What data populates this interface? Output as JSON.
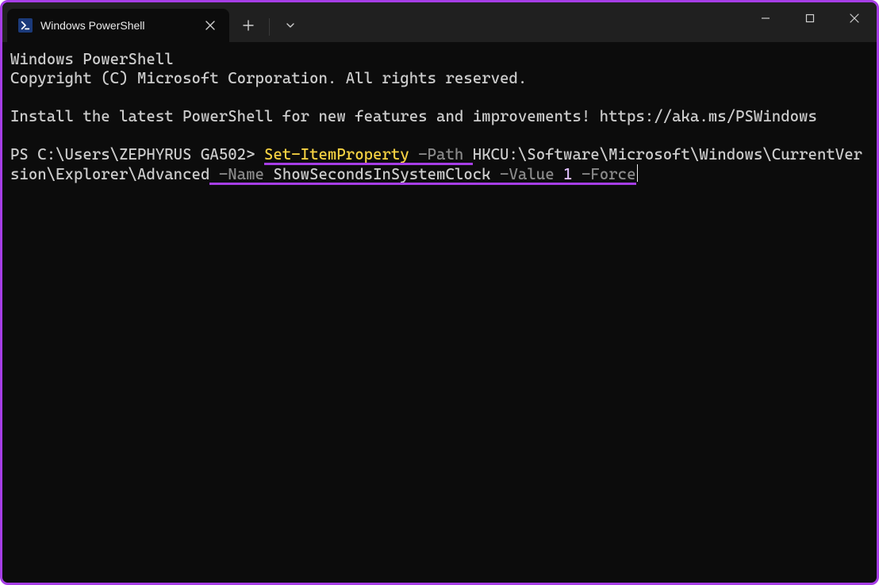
{
  "colors": {
    "accent": "#a63ee6"
  },
  "tab": {
    "title": "Windows PowerShell"
  },
  "terminal": {
    "header_line1": "Windows PowerShell",
    "header_line2": "Copyright (C) Microsoft Corporation. All rights reserved.",
    "install_msg": "Install the latest PowerShell for new features and improvements! https://aka.ms/PSWindows",
    "prompt_prefix": "PS ",
    "prompt_path": "C:\\Users\\ZEPHYRUS GA502",
    "prompt_suffix": "> ",
    "command": {
      "cmdlet": "Set-ItemProperty",
      "param1": {
        "dash": "-",
        "name": "Path",
        "value": "HKCU:\\Software\\Microsoft\\Windows\\CurrentVersion\\Explorer\\Advanced"
      },
      "param2": {
        "dash": "-",
        "name": "Name",
        "value": "ShowSecondsInSystemClock"
      },
      "param3": {
        "dash": "-",
        "name": "Value",
        "value": "1"
      },
      "param4": {
        "dash": "-",
        "name": "Force"
      }
    }
  }
}
